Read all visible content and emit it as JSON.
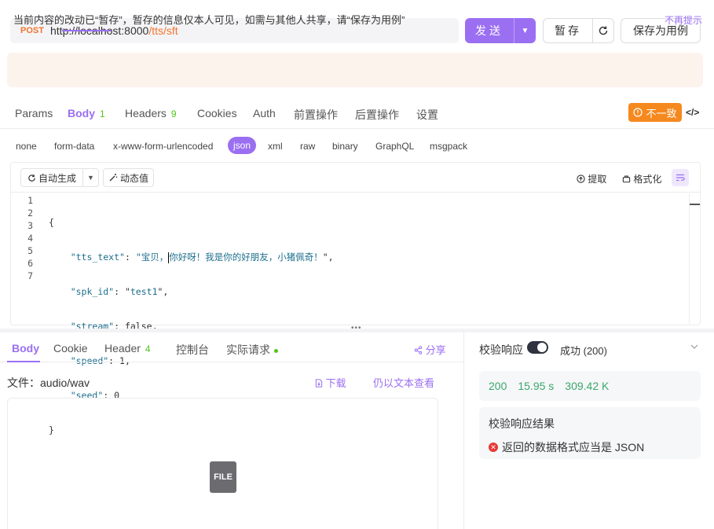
{
  "request": {
    "method": "POST",
    "url_base": "http://localhost:8000",
    "url_path": "/tts/sft",
    "send_label": "发送",
    "save_label": "暂存",
    "save_as_label": "保存为用例"
  },
  "notice": {
    "text": "当前内容的改动已“暂存”，暂存的信息仅本人可见，如需与其他人共享，请“保存为用例”",
    "dismiss": "不再提示"
  },
  "tabs": [
    {
      "label": "Params",
      "count": ""
    },
    {
      "label": "Body",
      "count": "1"
    },
    {
      "label": "Headers",
      "count": "9"
    },
    {
      "label": "Cookies",
      "count": ""
    },
    {
      "label": "Auth",
      "count": ""
    },
    {
      "label": "前置操作",
      "count": ""
    },
    {
      "label": "后置操作",
      "count": ""
    },
    {
      "label": "设置",
      "count": ""
    }
  ],
  "mismatch_badge": "不一致",
  "body_types": [
    "none",
    "form-data",
    "x-www-form-urlencoded",
    "json",
    "xml",
    "raw",
    "binary",
    "GraphQL",
    "msgpack"
  ],
  "editor": {
    "autogen": "自动生成",
    "dynamic_value": "动态值",
    "extract": "提取",
    "format": "格式化",
    "line_numbers": [
      "1",
      "2",
      "3",
      "4",
      "5",
      "6",
      "7"
    ],
    "json": {
      "tts_text": "宝贝，你好呀！我是你的好朋友，小猪佩奇！",
      "spk_id": "test1",
      "stream": "false",
      "speed": "1",
      "seed": "0"
    }
  },
  "response": {
    "tabs": [
      {
        "label": "Body",
        "count": ""
      },
      {
        "label": "Cookie",
        "count": ""
      },
      {
        "label": "Header",
        "count": "4"
      },
      {
        "label": "控制台",
        "count": ""
      },
      {
        "label": "实际请求",
        "count": ""
      }
    ],
    "share": "分享",
    "file_label": "文件：audio/wav",
    "download": "下载",
    "view_as_text": "仍以文本查看",
    "file_icon_text": "FILE"
  },
  "validation": {
    "title": "校验响应",
    "status": "成功 (200)",
    "status_code": "200",
    "time": "15.95 s",
    "size": "309.42 K",
    "result_title": "校验响应结果",
    "result_error": "返回的数据格式应当是 JSON"
  },
  "colors": {
    "accent": "#9b6ff2",
    "method": "#f2742f",
    "success": "#3aa86b",
    "warning": "#f5891e",
    "error": "#e53935"
  }
}
